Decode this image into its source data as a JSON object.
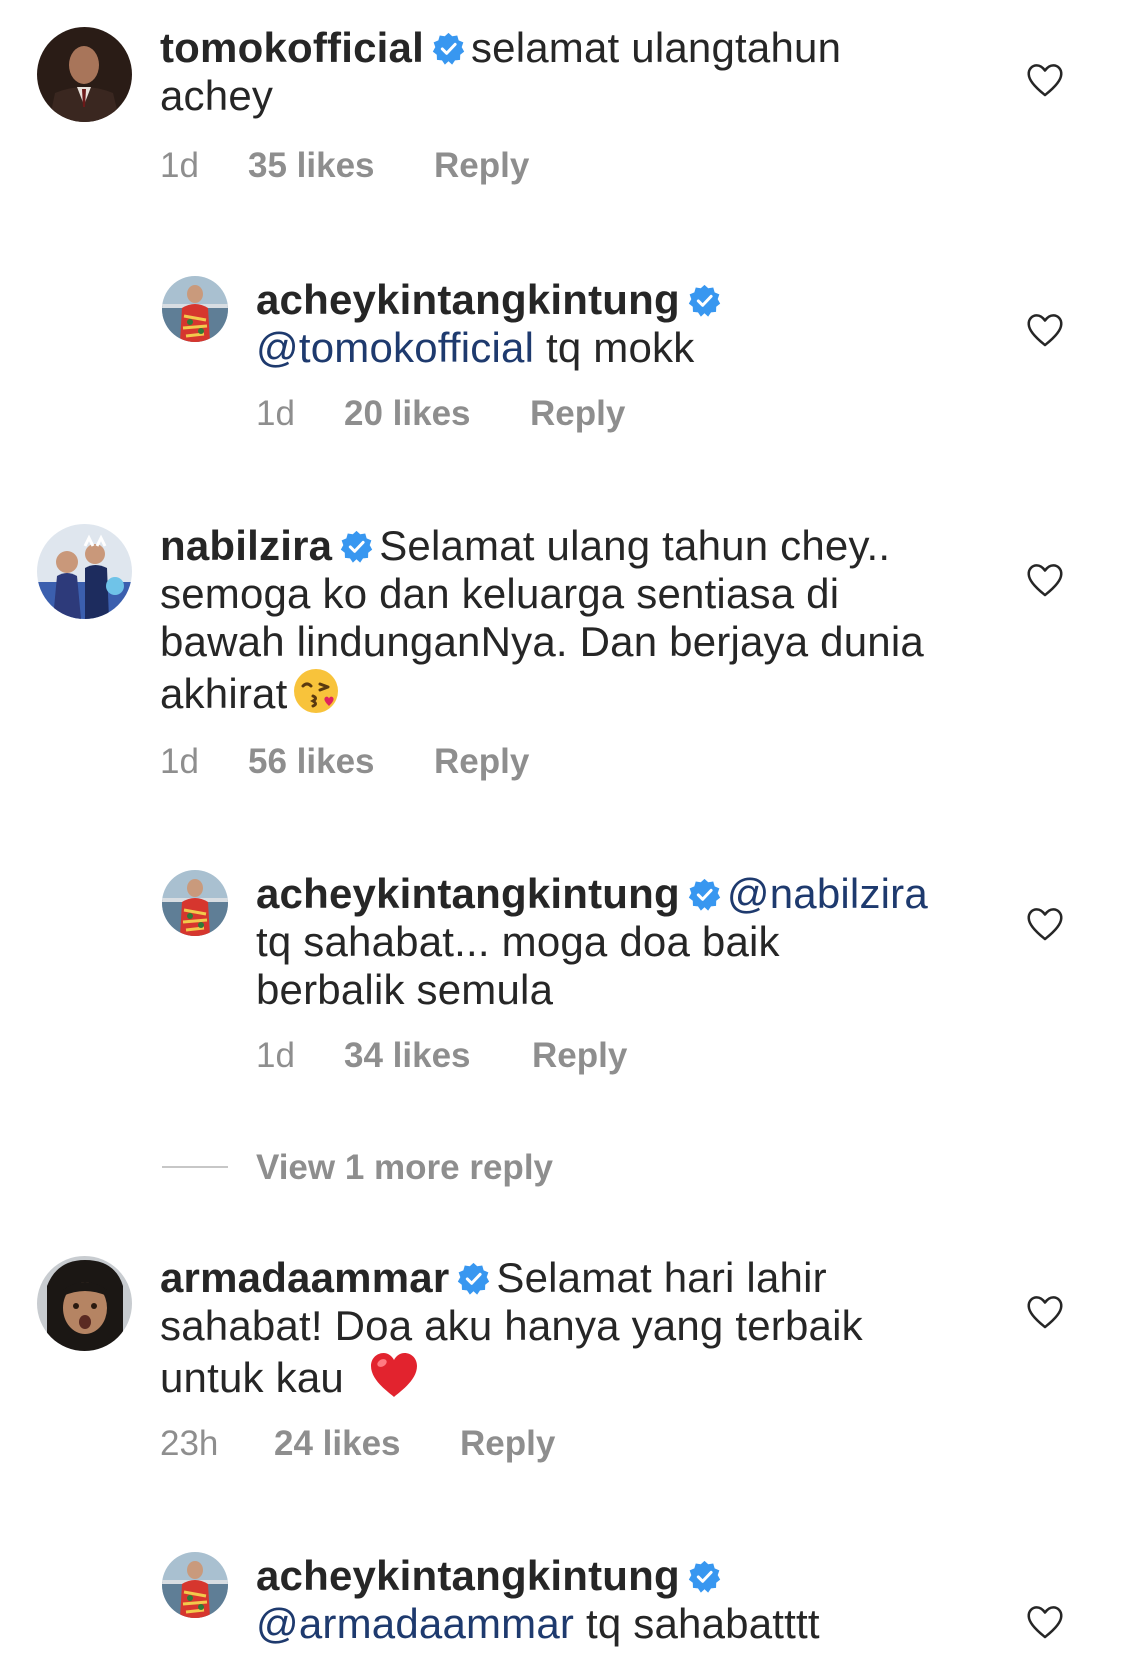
{
  "comments": [
    {
      "username": "tomokofficial",
      "verified": true,
      "text_line1": "selamat ulangtahun",
      "text_line2": "achey",
      "time": "1d",
      "likes": "35 likes",
      "reply": "Reply",
      "avatar_icon": "profile-photo-man-in-suit"
    },
    {
      "username": "acheykintangkintung",
      "verified": true,
      "mention": "@tomokofficial",
      "text": "tq mokk",
      "time": "1d",
      "likes": "20 likes",
      "reply": "Reply",
      "avatar_icon": "profile-photo-man-red-shirt"
    },
    {
      "username": "nabilzira",
      "verified": true,
      "text_line1": "Selamat ulang tahun chey..",
      "text_line2": "semoga ko dan keluarga sentiasa di",
      "text_line3": "bawah lindunganNya. Dan berjaya dunia",
      "text_line4": "akhirat",
      "emoji": "face-blowing-kiss",
      "time": "1d",
      "likes": "56 likes",
      "reply": "Reply",
      "avatar_icon": "profile-photo-family"
    },
    {
      "username": "acheykintangkintung",
      "verified": true,
      "mention": "@nabilzira",
      "text_line2": "tq sahabat... moga doa baik",
      "text_line3": "berbalik semula",
      "time": "1d",
      "likes": "34 likes",
      "reply": "Reply",
      "avatar_icon": "profile-photo-man-red-shirt"
    },
    {
      "username": "armadaammar",
      "verified": true,
      "text_line1": "Selamat hari lahir",
      "text_line2": "sahabat! Doa aku hanya yang terbaik",
      "text_line3": "untuk kau",
      "emoji": "red-heart",
      "time": "23h",
      "likes": "24 likes",
      "reply": "Reply",
      "avatar_icon": "profile-photo-man-long-hair"
    },
    {
      "username": "acheykintangkintung",
      "verified": true,
      "mention": "@armadaammar",
      "text": "tq sahabatttt",
      "avatar_icon": "profile-photo-man-red-shirt"
    }
  ],
  "view_more": "View 1 more reply",
  "colors": {
    "text": "#262626",
    "meta": "#8e8e8e",
    "mention": "#1e3a6e",
    "verified": "#3897f0"
  }
}
